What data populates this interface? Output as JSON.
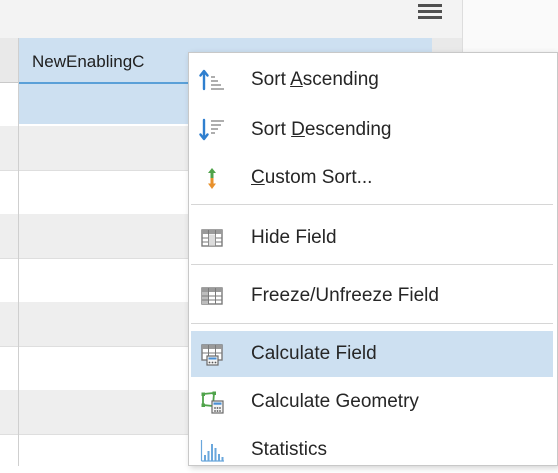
{
  "header": {
    "column_label": "NewEnablingC"
  },
  "context_menu": {
    "items": [
      {
        "id": "sort-ascending",
        "pre": "Sort ",
        "accel": "A",
        "post": "scending",
        "icon": "sort-ascending-icon"
      },
      {
        "id": "sort-descending",
        "pre": "Sort ",
        "accel": "D",
        "post": "escending",
        "icon": "sort-descending-icon"
      },
      {
        "id": "custom-sort",
        "pre": "",
        "accel": "C",
        "post": "ustom Sort...",
        "icon": "custom-sort-icon"
      },
      {
        "id": "hide-field",
        "label": "Hide Field",
        "icon": "hide-field-icon"
      },
      {
        "id": "freeze-field",
        "label": "Freeze/Unfreeze Field",
        "icon": "freeze-field-icon"
      },
      {
        "id": "calculate-field",
        "label": "Calculate Field",
        "icon": "calculate-field-icon",
        "active": true
      },
      {
        "id": "calculate-geometry",
        "label": "Calculate Geometry",
        "icon": "calculate-geometry-icon"
      },
      {
        "id": "statistics",
        "label": "Statistics",
        "icon": "statistics-icon"
      }
    ]
  },
  "colors": {
    "highlight": "#cde0f1",
    "accent_blue": "#2f7fcf",
    "accent_orange": "#e8912c",
    "accent_green": "#4fa34a"
  }
}
